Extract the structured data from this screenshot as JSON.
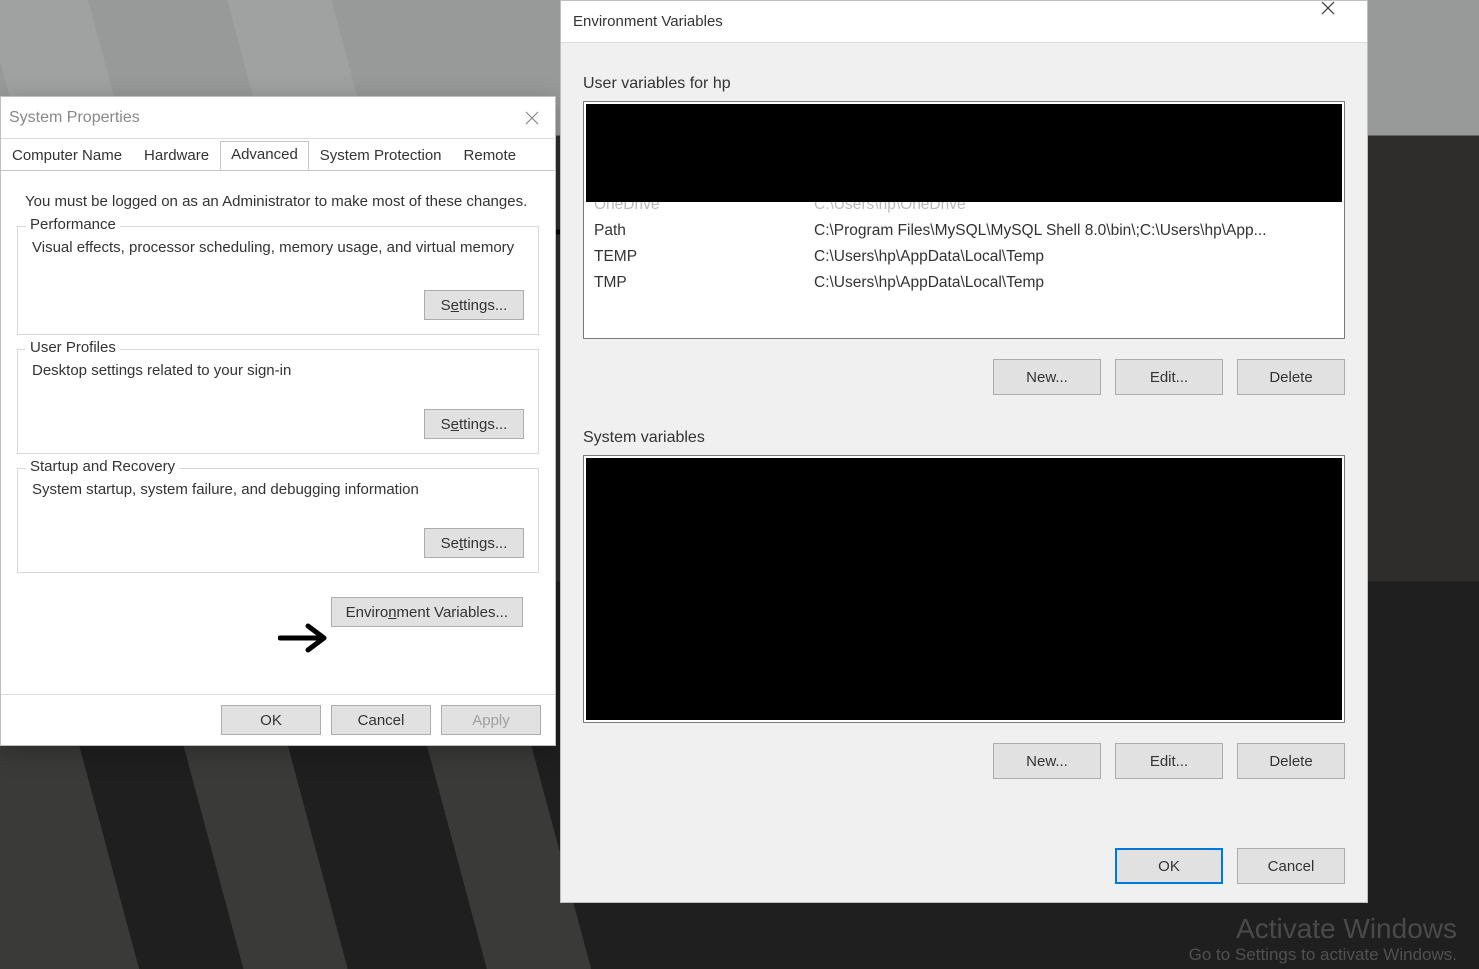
{
  "sysprops": {
    "title": "System Properties",
    "tabs": {
      "computer_name": "Computer Name",
      "hardware": "Hardware",
      "advanced": "Advanced",
      "system_protection": "System Protection",
      "remote": "Remote"
    },
    "admin_note": "You must be logged on as an Administrator to make most of these changes.",
    "groups": {
      "performance": {
        "label": "Performance",
        "desc": "Visual effects, processor scheduling, memory usage, and virtual memory",
        "button_prefix": "S",
        "button_u": "e",
        "button_suffix": "ttings..."
      },
      "user_profiles": {
        "label": "User Profiles",
        "desc": "Desktop settings related to your sign-in",
        "button_prefix": "S",
        "button_u": "e",
        "button_suffix": "ttings..."
      },
      "startup": {
        "label": "Startup and Recovery",
        "desc": "System startup, system failure, and debugging information",
        "button_prefix": "Se",
        "button_u": "t",
        "button_suffix": "tings..."
      }
    },
    "envbtn": {
      "prefix": "Enviro",
      "u": "n",
      "suffix": "ment Variables..."
    },
    "footer": {
      "ok": "OK",
      "cancel": "Cancel",
      "apply": "Apply"
    }
  },
  "envdlg": {
    "title": "Environment Variables",
    "user_section_label": "User variables for hp",
    "user_vars": [
      {
        "name": "OneDrive",
        "value": "C:\\Users\\hp\\OneDrive"
      },
      {
        "name": "Path",
        "value": "C:\\Program Files\\MySQL\\MySQL Shell 8.0\\bin\\;C:\\Users\\hp\\App..."
      },
      {
        "name": "TEMP",
        "value": "C:\\Users\\hp\\AppData\\Local\\Temp"
      },
      {
        "name": "TMP",
        "value": "C:\\Users\\hp\\AppData\\Local\\Temp"
      }
    ],
    "sys_section_label": "System variables",
    "buttons": {
      "new": "New...",
      "edit": "Edit...",
      "delete": "Delete",
      "ok": "OK",
      "cancel": "Cancel"
    }
  },
  "watermark": {
    "line1": "Activate Windows",
    "line2": "Go to Settings to activate Windows."
  }
}
